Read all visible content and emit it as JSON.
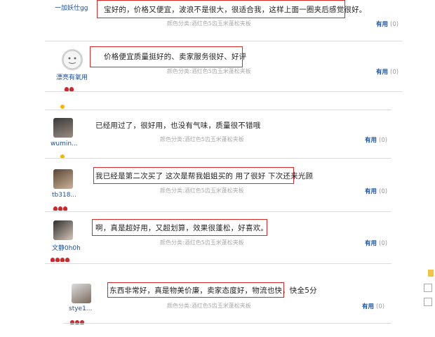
{
  "reviews": [
    {
      "username": "一加妖仕gg",
      "level_gems": 0,
      "comment": "宝好的，价格又便宜，波浪不是很大，很适合我，这样上面一圈夹后感觉很好。",
      "meta": "颜色分类:酒红色5齿玉米蓬松夹板",
      "useful_label": "有用",
      "useful_count": "(0)"
    },
    {
      "username": "漂亮有氧用",
      "level_gems": 2,
      "comment": "价格便宜质量挺好的、卖家服务很好、好评",
      "meta": "颜色分类:酒红色5齿玉米蓬松夹板",
      "useful_label": "有用",
      "useful_count": "(0)"
    },
    {
      "username": "wumin...",
      "level_gems": 0,
      "comment": "已经用过了，很好用，也没有气味，质量很不错哦",
      "meta": "颜色分类:酒红色5齿玉米蓬松夹板",
      "useful_label": "有用",
      "useful_count": "(0)"
    },
    {
      "username": "tb318...",
      "level_gems": 3,
      "comment": "我已经是第二次买了 这次是帮我姐姐买的 用了很好 下次还来光顾",
      "meta": "颜色分类:酒红色5齿玉米蓬松夹板",
      "useful_label": "有用",
      "useful_count": "(0)"
    },
    {
      "username": "文静0h0h",
      "level_gems": 4,
      "comment": "啊，真是超好用，又超划算，效果很蓬松，好喜欢。",
      "meta": "颜色分类:酒红色5齿玉米蓬松夹板",
      "useful_label": "有用",
      "useful_count": "(0)"
    },
    {
      "username": "stye1...",
      "level_gems": 3,
      "comment": "东西非常好，真是物美价廉，卖家态度好，物流也快，快全5分",
      "meta": "颜色分类:酒红色5齿玉米蓬松夹板",
      "useful_label": "有用",
      "useful_count": "(0)"
    }
  ],
  "colors": {
    "highlight_box": "#d82828",
    "link_blue": "#1a4f9c",
    "gem_red": "#d3262b",
    "coin_gold": "#f3b600"
  }
}
